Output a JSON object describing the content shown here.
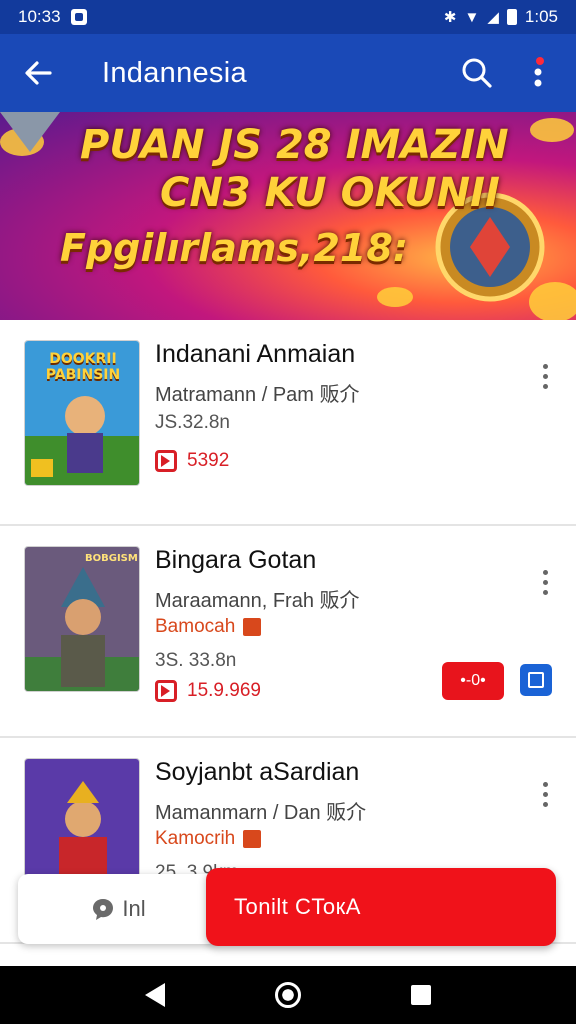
{
  "status_bar": {
    "time": "10:33",
    "clock_right": "1:05"
  },
  "app_bar": {
    "title": "Indannesia"
  },
  "banner": {
    "line1": "PUAN JS 28 IMAZIN",
    "line2": "CN3 KU OKUNII",
    "line3": "Fpgilırlams,218:"
  },
  "items": [
    {
      "title": "Indanani Anmaian",
      "subtitle": "Matramann / Pam 贩介",
      "size": "JS.32.8n",
      "count": "5392",
      "thumb_text": "DOOKRII PABINSIN"
    },
    {
      "title": "Bingara Gotan",
      "subtitle": "Maraamann, Frah 贩介",
      "tag": "Bamocah",
      "size": "3S. 33.8n",
      "count": "15.9.969",
      "action_label": "•-0•",
      "thumb_text": "BOBGISM"
    },
    {
      "title": "Soyjanbt aSardian",
      "subtitle": "Mamanmarn / Dan 贩介",
      "tag": "Kamocrih",
      "size": "25. 3.9km"
    }
  ],
  "bottom_actions": {
    "secondary_label": "Inl",
    "primary_label": "Tonilt CToкA"
  },
  "colors": {
    "status_bar": "#123a9c",
    "app_bar": "#1a49b7",
    "accent_red": "#e8141c",
    "accent_blue": "#1a63d6"
  }
}
